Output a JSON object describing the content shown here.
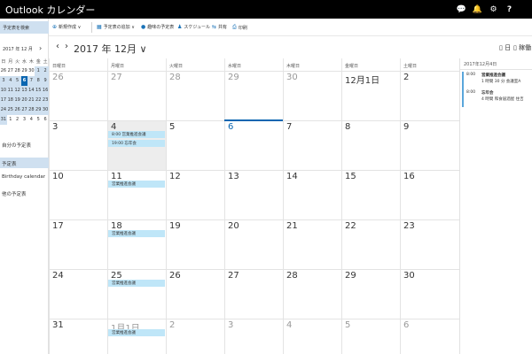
{
  "app": {
    "title": "Outlook カレンダー"
  },
  "titlebar_icons": [
    {
      "name": "chat-icon",
      "glyph": "💬"
    },
    {
      "name": "bell-icon",
      "glyph": "🔔"
    },
    {
      "name": "gear-icon",
      "glyph": "⚙"
    },
    {
      "name": "help-icon",
      "glyph": "?"
    }
  ],
  "toolbar": {
    "new_label": "新規作成",
    "add_calendar_label": "予定表の追加",
    "interests_label": "趣味の予定表",
    "schedule_label": "スケジュール",
    "share_label": "共有",
    "print_label": "印刷"
  },
  "sidebar": {
    "search_label": "予定表を検索",
    "mini_title": "2017 年 12 月",
    "mini_dow": [
      "日",
      "月",
      "火",
      "水",
      "木",
      "金",
      "土"
    ],
    "mini_weeks": [
      [
        "26",
        "27",
        "28",
        "29",
        "30",
        "1",
        "2"
      ],
      [
        "3",
        "4",
        "5",
        "6",
        "7",
        "8",
        "9"
      ],
      [
        "10",
        "11",
        "12",
        "13",
        "14",
        "15",
        "16"
      ],
      [
        "17",
        "18",
        "19",
        "20",
        "21",
        "22",
        "23"
      ],
      [
        "24",
        "25",
        "26",
        "27",
        "28",
        "29",
        "30"
      ],
      [
        "31",
        "1",
        "2",
        "3",
        "4",
        "5",
        "6"
      ]
    ],
    "items": [
      {
        "label": "自分の予定表"
      },
      {
        "label": "予定表"
      },
      {
        "label": "Birthday calendar"
      },
      {
        "label": "他の予定表"
      }
    ]
  },
  "calendar": {
    "month_title": "2017 年 12月",
    "view_label": "日",
    "workweek_label": "稼働日",
    "week_label": "週",
    "dow": [
      "日曜日",
      "月曜日",
      "火曜日",
      "水曜日",
      "木曜日",
      "金曜日",
      "土曜日"
    ],
    "weeks": [
      [
        "26",
        "27",
        "28",
        "29",
        "30",
        "12月1日",
        "2"
      ],
      [
        "3",
        "4",
        "5",
        "6",
        "7",
        "8",
        "9"
      ],
      [
        "10",
        "11",
        "12",
        "13",
        "14",
        "15",
        "16"
      ],
      [
        "17",
        "18",
        "19",
        "20",
        "21",
        "22",
        "23"
      ],
      [
        "24",
        "25",
        "26",
        "27",
        "28",
        "29",
        "30"
      ],
      [
        "31",
        "1月1日",
        "2",
        "3",
        "4",
        "5",
        "6"
      ]
    ],
    "events": {
      "w1_mon_1": "8:00 営業推進会議",
      "w1_mon_2": "19:00 忘年会",
      "w2_mon": "営業推進会議",
      "w3_mon": "営業推進会議",
      "w4_mon": "営業推進会議",
      "w5_mon": "営業推進会議"
    }
  },
  "agenda": {
    "header": "2017年12月4日",
    "items": [
      {
        "time": "8:00",
        "title": "営業推進会議",
        "detail": "1 時間 30 分  会議室A"
      },
      {
        "time": "8:00",
        "title": "忘年会",
        "detail": "4 時間  和食居酒屋 住吉"
      }
    ]
  },
  "colors": {
    "titlebar": "#000000",
    "accent": "#0a66b1",
    "event": "#bfe6f8",
    "selection": "#cfe0f0"
  }
}
